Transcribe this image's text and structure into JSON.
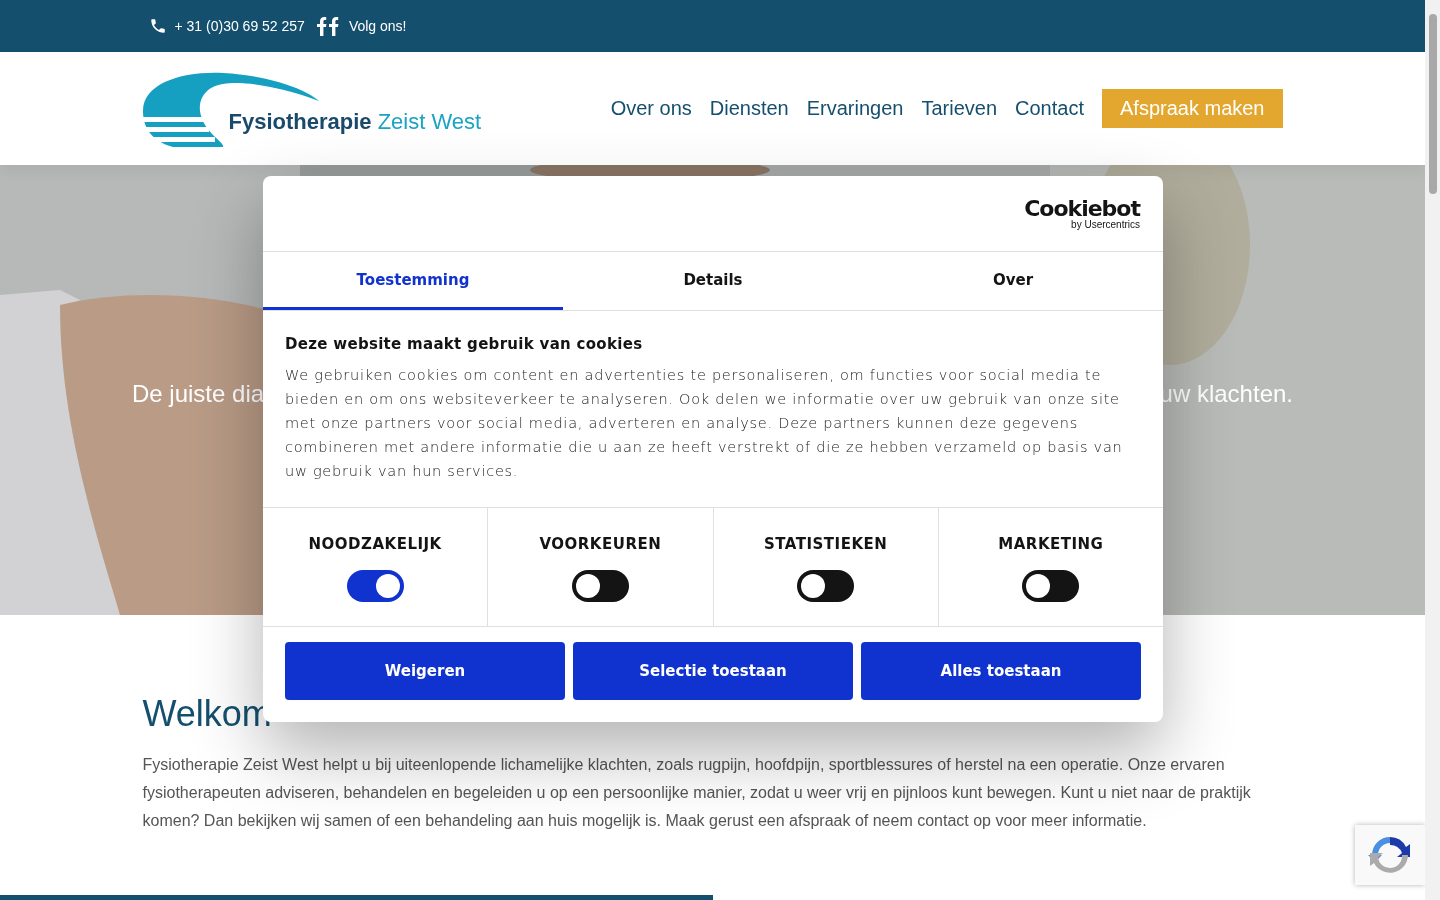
{
  "topbar": {
    "phone": "+ 31 (0)30 69 52 257",
    "social": "Volg ons!"
  },
  "logo": {
    "name": "Fysiotherapie",
    "place": "Zeist West"
  },
  "nav": {
    "items": [
      {
        "label": "Over ons"
      },
      {
        "label": "Diensten"
      },
      {
        "label": "Ervaringen"
      },
      {
        "label": "Tarieven"
      },
      {
        "label": "Contact"
      }
    ],
    "cta": "Afspraak maken"
  },
  "hero": {
    "text_left": "De juiste dia",
    "text_right": "uw klachten."
  },
  "dialog": {
    "brand": "Cookiebot",
    "brand_sub": "by Usercentrics",
    "tabs": [
      {
        "label": "Toestemming",
        "selected": true
      },
      {
        "label": "Details",
        "selected": false
      },
      {
        "label": "Over",
        "selected": false
      }
    ],
    "title": "Deze website maakt gebruik van cookies",
    "body": "We gebruiken cookies om content en advertenties te personaliseren, om functies voor social media te bieden en om ons websiteverkeer te analyseren. Ook delen we informatie over uw gebruik van onze site met onze partners voor social media, adverteren en analyse. Deze partners kunnen deze gegevens combineren met andere informatie die u aan ze heeft verstrekt of die ze hebben verzameld op basis van uw gebruik van hun services.",
    "categories": [
      {
        "label": "NOODZAKELIJK",
        "checked": true
      },
      {
        "label": "VOORKEUREN",
        "checked": false
      },
      {
        "label": "STATISTIEKEN",
        "checked": false
      },
      {
        "label": "MARKETING",
        "checked": false
      }
    ],
    "buttons": [
      "Weigeren",
      "Selectie toestaan",
      "Alles toestaan"
    ]
  },
  "welcome": {
    "heading": "Welkom",
    "paragraph": "Fysiotherapie Zeist West helpt u bij uiteenlopende lichamelijke klachten, zoals rugpijn, hoofdpijn, sportblessures of herstel na een operatie. Onze ervaren fysiotherapeuten adviseren, behandelen en begeleiden u op een persoonlijke manier, zodat u weer vrij en pijnloos kunt bewegen. Kunt u niet naar de praktijk komen? Dan bekijken wij samen of een behandeling aan huis mogelijk is. Maak gerust een afspraak of neem contact op voor meer informatie."
  }
}
